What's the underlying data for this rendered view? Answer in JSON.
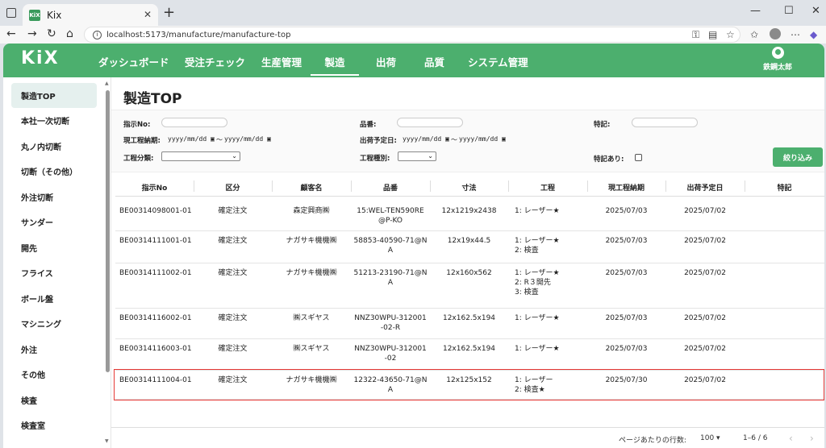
{
  "browser": {
    "tab_title": "Kix",
    "favicon_text": "KiX",
    "url": "localhost:5173/manufacture/manufacture-top"
  },
  "app": {
    "logo": "KiX",
    "nav": [
      {
        "label": "ダッシュボード"
      },
      {
        "label": "受注チェック"
      },
      {
        "label": "生産管理"
      },
      {
        "label": "製造"
      },
      {
        "label": "出荷"
      },
      {
        "label": "品質"
      },
      {
        "label": "システム管理"
      }
    ],
    "active_nav": "製造",
    "user_name": "鉄鋼太郎"
  },
  "sidebar": {
    "items": [
      {
        "label": "製造TOP"
      },
      {
        "label": "本社一次切断"
      },
      {
        "label": "丸ノ内切断"
      },
      {
        "label": "切断（その他）"
      },
      {
        "label": "外注切断"
      },
      {
        "label": "サンダー"
      },
      {
        "label": "開先"
      },
      {
        "label": "フライス"
      },
      {
        "label": "ボール盤"
      },
      {
        "label": "マシニング"
      },
      {
        "label": "外注"
      },
      {
        "label": "その他"
      },
      {
        "label": "検査"
      },
      {
        "label": "検査室"
      }
    ]
  },
  "page": {
    "title": "製造TOP"
  },
  "filters": {
    "order_no_label": "指示No:",
    "part_no_label": "品番:",
    "note_label": "特記:",
    "due_label": "現工程納期:",
    "ship_label": "出荷予定日:",
    "date_placeholder": "yyyy/mm/dd",
    "range_sep": "〜",
    "process_class_label": "工程分類:",
    "process_type_label": "工程種別:",
    "has_note_label": "特記あり:",
    "submit_label": "絞り込み"
  },
  "table": {
    "headers": [
      "指示No",
      "区分",
      "顧客名",
      "品番",
      "寸法",
      "工程",
      "現工程納期",
      "出荷予定日",
      "特記"
    ],
    "rows": [
      {
        "no": "BE00314098001-01",
        "kubun": "確定注文",
        "customer": "森定興商㈱",
        "part": [
          "15:WEL-TEN590RE",
          "@P-KO"
        ],
        "size": "12x1219x2438",
        "process": [
          "1: レーザー★"
        ],
        "due": "2025/07/03",
        "ship": "2025/07/02",
        "note": ""
      },
      {
        "no": "BE00314111001-01",
        "kubun": "確定注文",
        "customer": "ナガサキ機機㈱",
        "part": [
          "58853-40590-71@N",
          "A"
        ],
        "size": "12x19x44.5",
        "process": [
          "1: レーザー★",
          "2: 検査"
        ],
        "due": "2025/07/03",
        "ship": "2025/07/02",
        "note": ""
      },
      {
        "no": "BE00314111002-01",
        "kubun": "確定注文",
        "customer": "ナガサキ機機㈱",
        "part": [
          "51213-23190-71@N",
          "A"
        ],
        "size": "12x160x562",
        "process": [
          "1: レーザー★",
          "2: R３開先",
          "3: 検査"
        ],
        "due": "2025/07/03",
        "ship": "2025/07/02",
        "note": ""
      },
      {
        "no": "BE00314116002-01",
        "kubun": "確定注文",
        "customer": "㈱スギヤス",
        "part": [
          "NNZ30WPU-312001",
          "-02-R"
        ],
        "size": "12x162.5x194",
        "process": [
          "1: レーザー★"
        ],
        "due": "2025/07/03",
        "ship": "2025/07/02",
        "note": ""
      },
      {
        "no": "BE00314116003-01",
        "kubun": "確定注文",
        "customer": "㈱スギヤス",
        "part": [
          "NNZ30WPU-312001",
          "-02"
        ],
        "size": "12x162.5x194",
        "process": [
          "1: レーザー★"
        ],
        "due": "2025/07/03",
        "ship": "2025/07/02",
        "note": ""
      },
      {
        "no": "BE00314111004-01",
        "kubun": "確定注文",
        "customer": "ナガサキ機機㈱",
        "part": [
          "12322-43650-71@N",
          "A"
        ],
        "size": "12x125x152",
        "process": [
          "1: レーザー",
          "2: 検査★"
        ],
        "due": "2025/07/30",
        "ship": "2025/07/02",
        "note": ""
      }
    ],
    "highlighted_row": 5
  },
  "pagination": {
    "rows_per_page_label": "ページあたりの行数:",
    "rows_per_page": "100",
    "range": "1–6 / 6"
  },
  "colors": {
    "brand": "#4caf6e",
    "highlight": "#e53935"
  }
}
